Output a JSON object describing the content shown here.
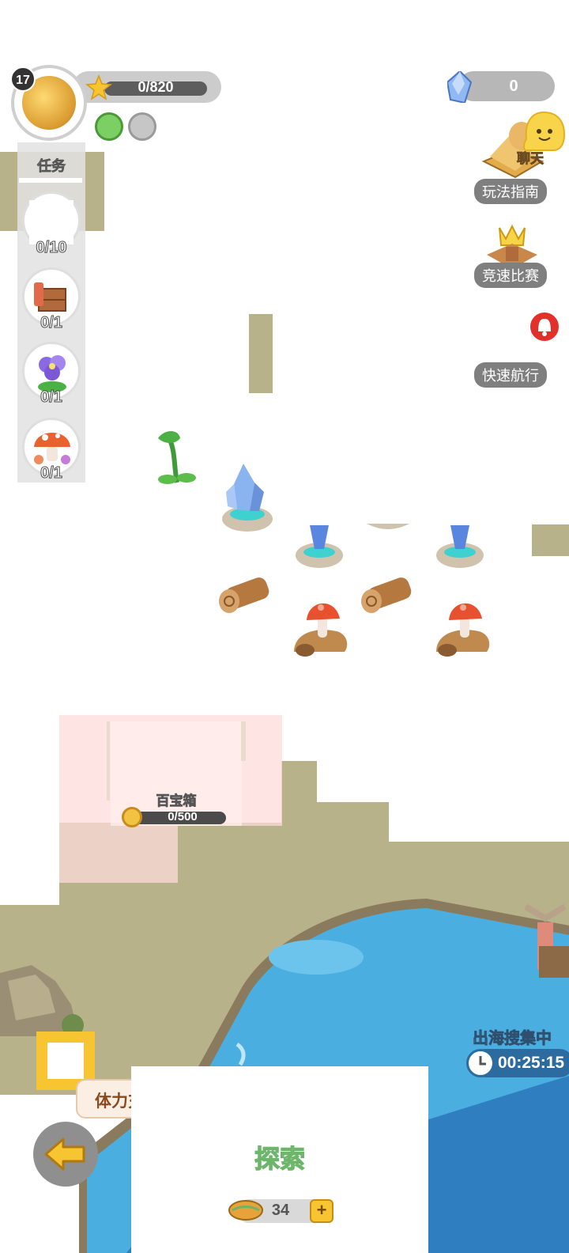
{
  "player": {
    "level": "17",
    "xp_text": "0/820"
  },
  "currency": {
    "gems": "0"
  },
  "tasks": {
    "title": "任务",
    "items": [
      {
        "count": "0/10",
        "icon": "blank-task-icon"
      },
      {
        "count": "0/1",
        "icon": "wood-crate-icon"
      },
      {
        "count": "0/1",
        "icon": "purple-flower-icon"
      },
      {
        "count": "0/1",
        "icon": "mushroom-icon"
      }
    ]
  },
  "side_menu": {
    "chat": "聊天",
    "guide": "玩法指南",
    "race": "竞速比赛",
    "fast_sail": "快速航行"
  },
  "treasure": {
    "label": "百宝箱",
    "progress": "0/500"
  },
  "sea": {
    "title": "出海搜集中",
    "timer": "00:25:15"
  },
  "bottom": {
    "hint": "体力充沛可以探索",
    "explore_label": "探索",
    "energy": "34"
  },
  "colors": {
    "sea": "#4aaee0",
    "sea_deep": "#2f7ec0",
    "terrain": "#b8b28a",
    "accent_yellow": "#f7c531",
    "explore_green": "#6db56a"
  }
}
